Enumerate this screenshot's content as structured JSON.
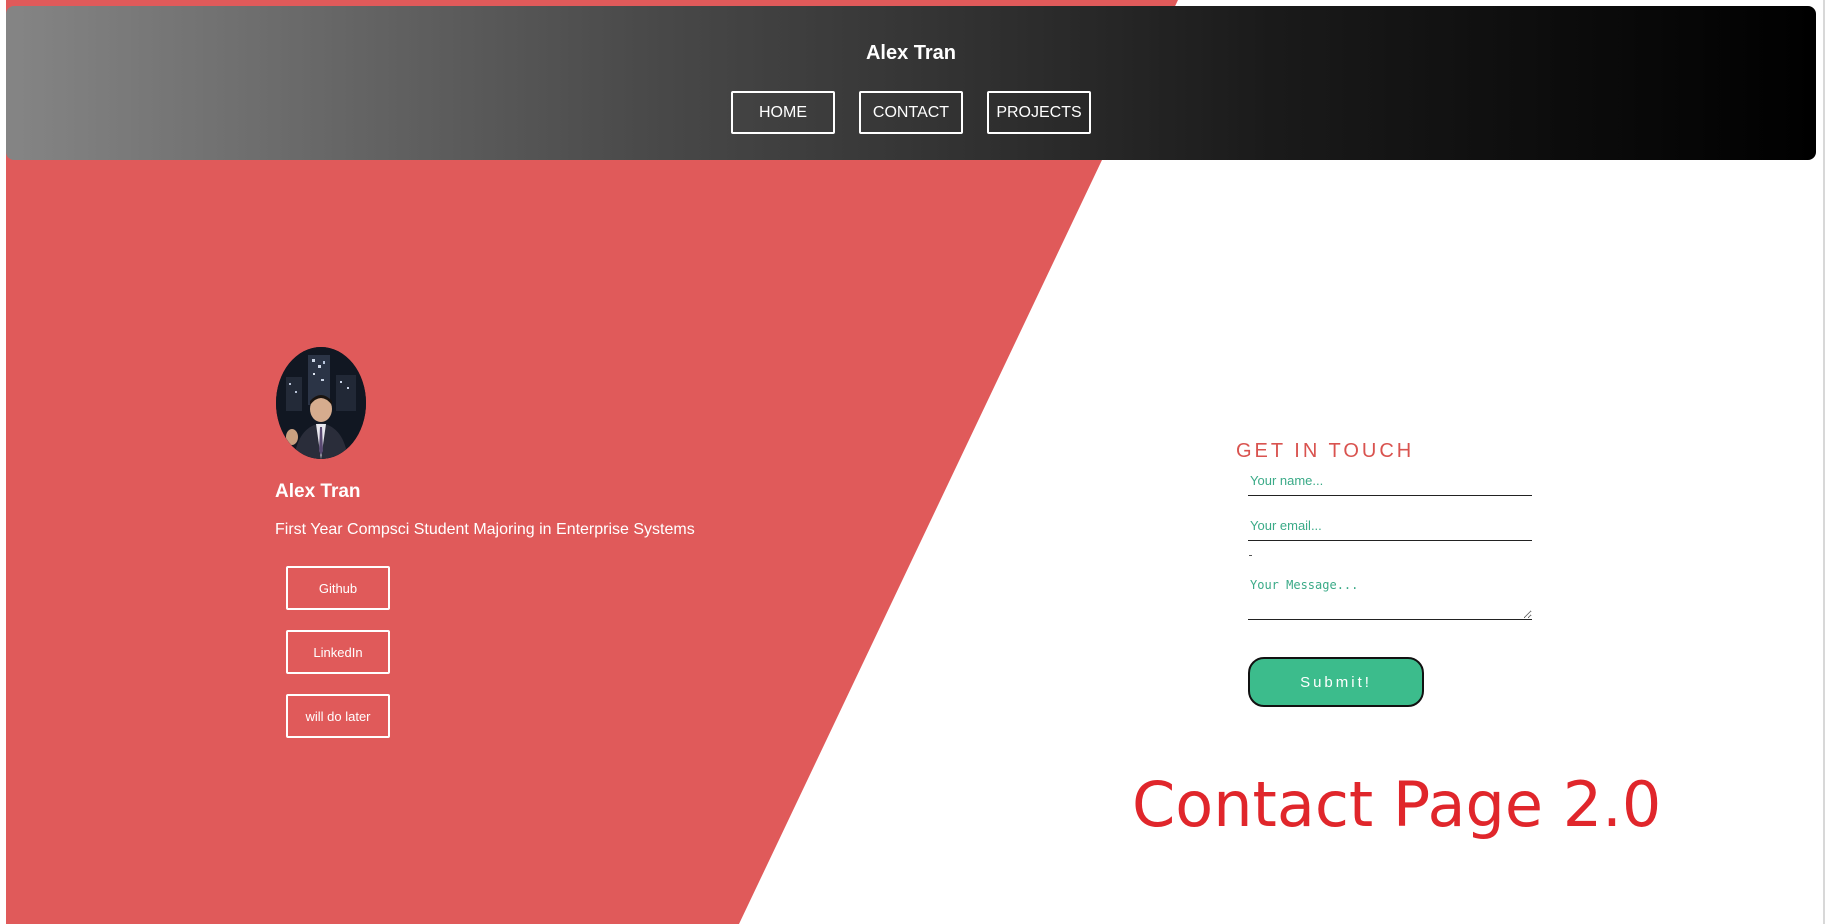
{
  "header": {
    "title": "Alex Tran",
    "nav": [
      {
        "label": "HOME"
      },
      {
        "label": "CONTACT"
      },
      {
        "label": "PROJECTS"
      }
    ]
  },
  "profile": {
    "name": "Alex Tran",
    "subtitle": "First Year Compsci Student Majoring in Enterprise Systems",
    "links": [
      {
        "label": "Github"
      },
      {
        "label": "LinkedIn"
      },
      {
        "label": "will do later"
      }
    ]
  },
  "contact": {
    "heading": "GET IN TOUCH",
    "name_placeholder": "Your name...",
    "email_placeholder": "Your email...",
    "message_placeholder": "Your Message...",
    "submit_label": "Submit!"
  },
  "page_heading": "Contact Page 2.0",
  "colors": {
    "panel_red": "#e05a5a",
    "accent_green": "#3cbc8c",
    "heading_red": "#e0262b"
  }
}
